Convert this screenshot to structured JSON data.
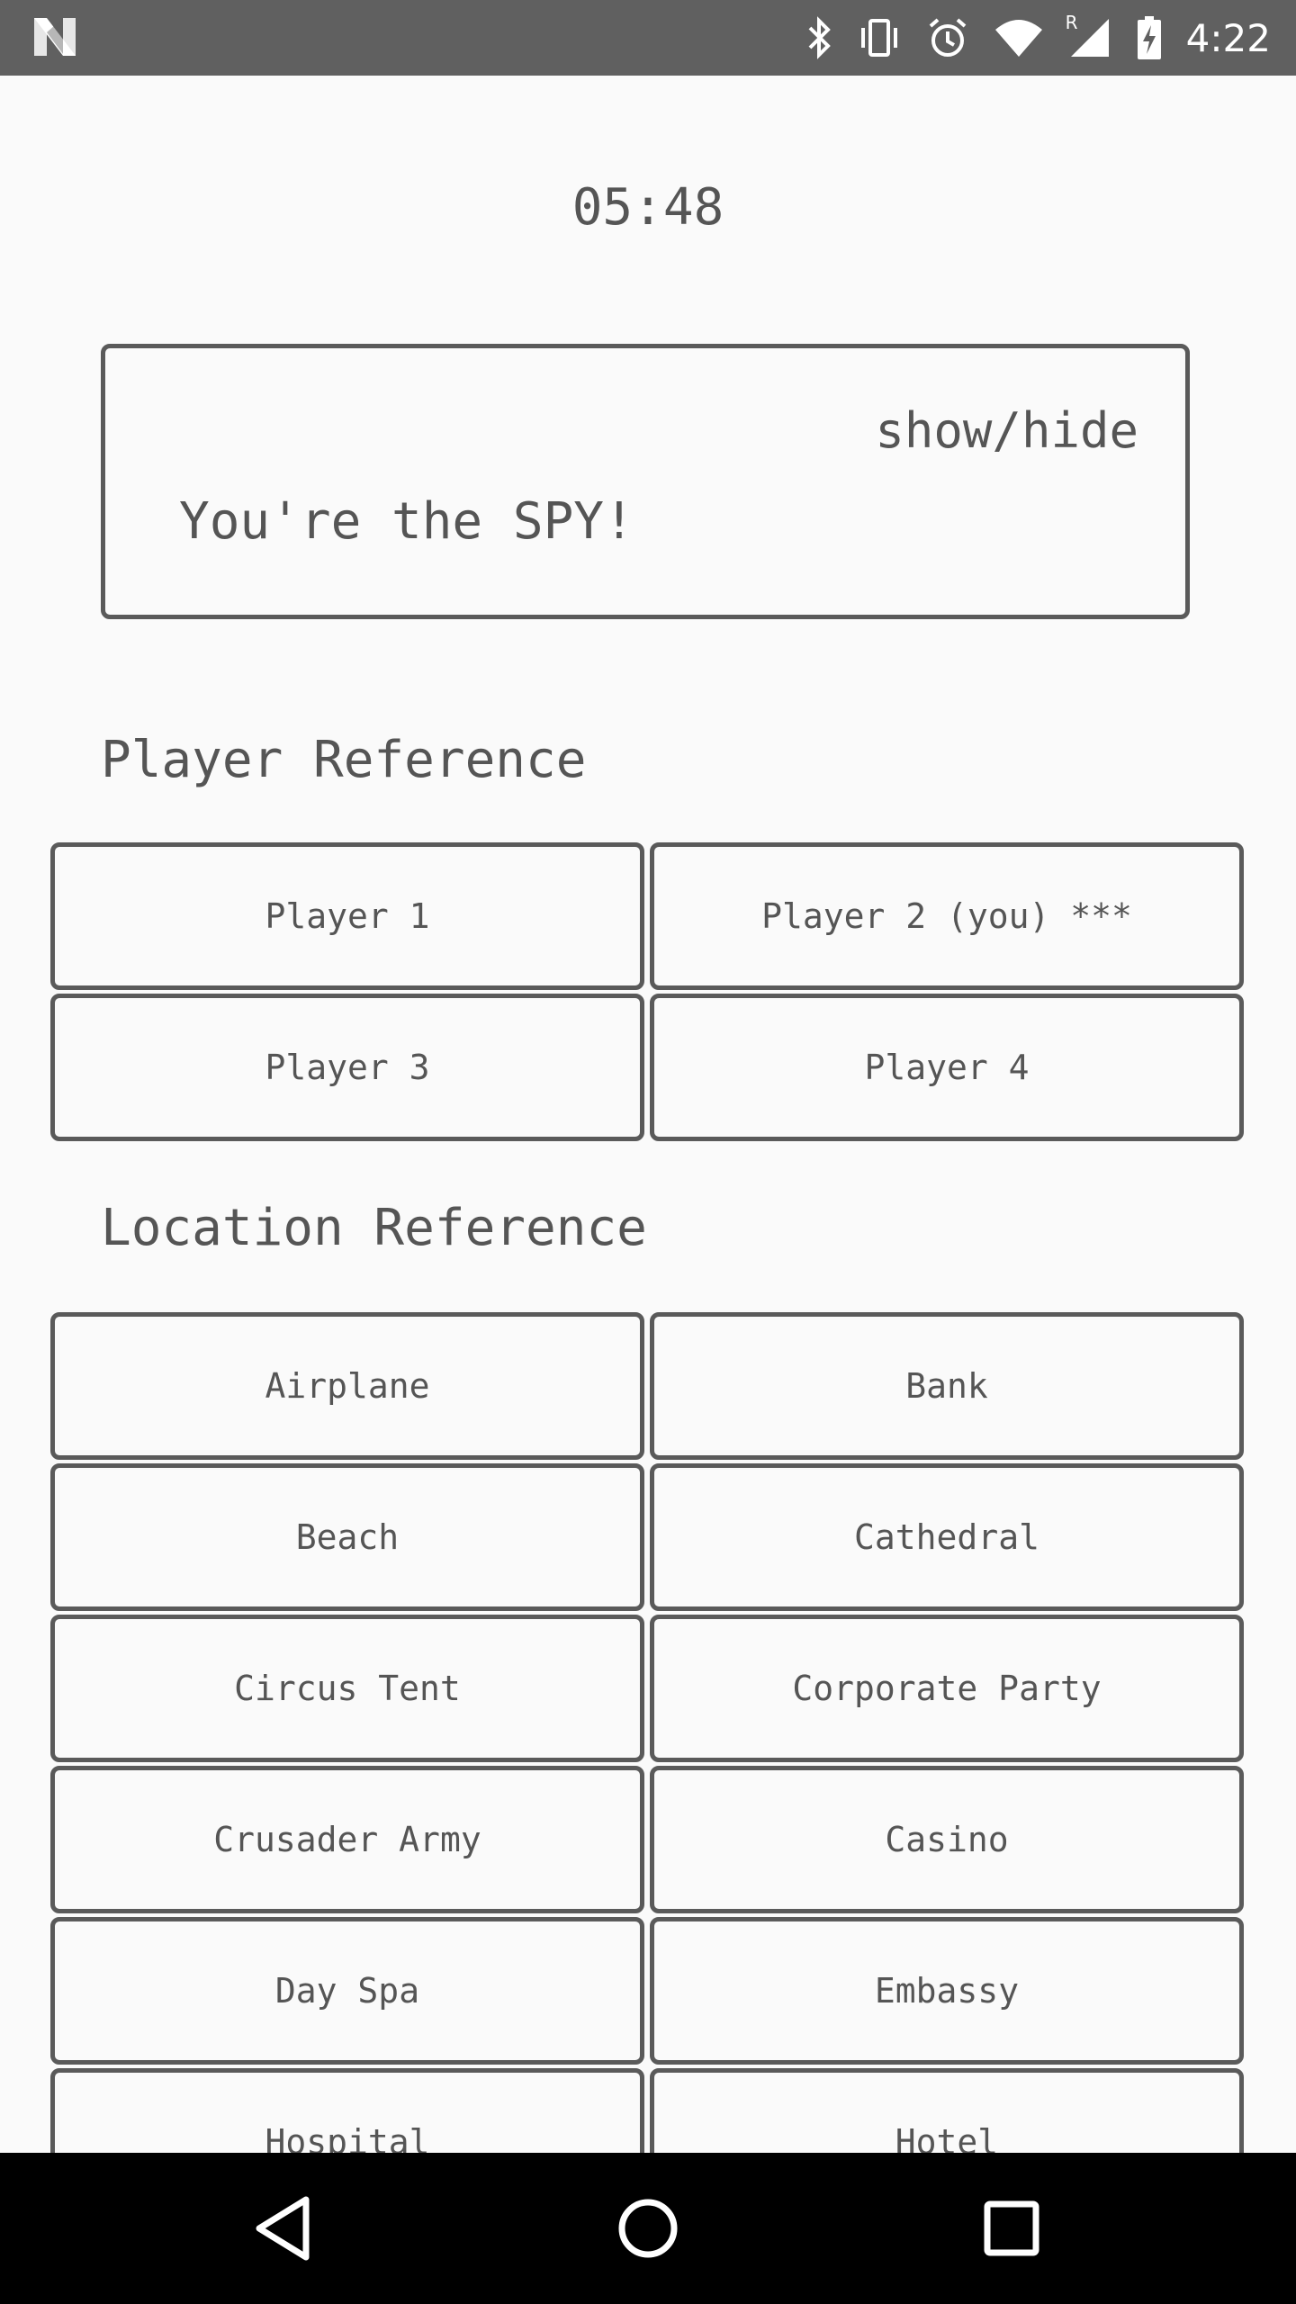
{
  "status_bar": {
    "time": "4:22",
    "icons": [
      "notification-n-icon",
      "bluetooth-icon",
      "vibrate-icon",
      "alarm-icon",
      "wifi-icon",
      "signal-roaming-icon",
      "battery-charging-icon"
    ],
    "roaming_label": "R"
  },
  "timer": "05:48",
  "role_card": {
    "toggle_label": "show/hide",
    "role_text": "You're the SPY!"
  },
  "players": {
    "heading": "Player Reference",
    "items": [
      {
        "label": "Player 1"
      },
      {
        "label": "Player 2 (you) ***"
      },
      {
        "label": "Player 3"
      },
      {
        "label": "Player 4"
      }
    ]
  },
  "locations": {
    "heading": "Location Reference",
    "items": [
      {
        "label": "Airplane"
      },
      {
        "label": "Bank"
      },
      {
        "label": "Beach"
      },
      {
        "label": "Cathedral"
      },
      {
        "label": "Circus Tent"
      },
      {
        "label": "Corporate Party"
      },
      {
        "label": "Crusader Army"
      },
      {
        "label": "Casino"
      },
      {
        "label": "Day Spa"
      },
      {
        "label": "Embassy"
      },
      {
        "label": "Hospital"
      },
      {
        "label": "Hotel"
      }
    ]
  },
  "nav_bar": {
    "buttons": [
      "back-icon",
      "home-icon",
      "recents-icon"
    ]
  },
  "colors": {
    "status_bar": "#606060",
    "background": "#fafafa",
    "text": "#555555",
    "border": "#5a5a5a",
    "nav_bar": "#000000"
  }
}
